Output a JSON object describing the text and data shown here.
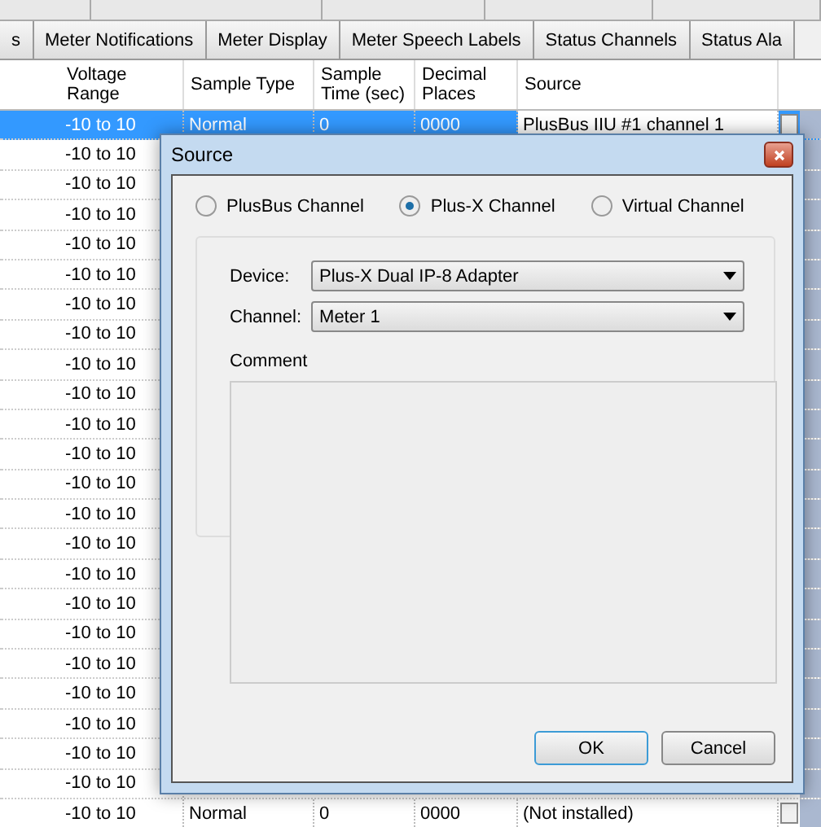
{
  "tabs": [
    {
      "label": "s",
      "selected": false
    },
    {
      "label": "Meter Notifications",
      "selected": false
    },
    {
      "label": "Meter Display",
      "selected": false
    },
    {
      "label": "Meter Speech Labels",
      "selected": false
    },
    {
      "label": "Status Channels",
      "selected": false
    },
    {
      "label": "Status Ala",
      "selected": false
    }
  ],
  "table": {
    "columns": [
      "Voltage Range",
      "Sample Type",
      "Sample Time (sec)",
      "Decimal Places",
      "Source"
    ],
    "rows": [
      {
        "selected": true,
        "cells": [
          "-10 to 10",
          "Normal",
          "0",
          "0000",
          "PlusBus IIU #1 channel 1"
        ]
      },
      {
        "selected": false,
        "cells": [
          "-10 to 10"
        ]
      },
      {
        "selected": false,
        "cells": [
          "-10 to 10"
        ]
      },
      {
        "selected": false,
        "cells": [
          "-10 to 10"
        ]
      },
      {
        "selected": false,
        "cells": [
          "-10 to 10"
        ]
      },
      {
        "selected": false,
        "cells": [
          "-10 to 10"
        ]
      },
      {
        "selected": false,
        "cells": [
          "-10 to 10"
        ]
      },
      {
        "selected": false,
        "cells": [
          "-10 to 10"
        ]
      },
      {
        "selected": false,
        "cells": [
          "-10 to 10"
        ]
      },
      {
        "selected": false,
        "cells": [
          "-10 to 10"
        ]
      },
      {
        "selected": false,
        "cells": [
          "-10 to 10"
        ]
      },
      {
        "selected": false,
        "cells": [
          "-10 to 10"
        ]
      },
      {
        "selected": false,
        "cells": [
          "-10 to 10"
        ]
      },
      {
        "selected": false,
        "cells": [
          "-10 to 10"
        ]
      },
      {
        "selected": false,
        "cells": [
          "-10 to 10"
        ]
      },
      {
        "selected": false,
        "cells": [
          "-10 to 10"
        ]
      },
      {
        "selected": false,
        "cells": [
          "-10 to 10"
        ]
      },
      {
        "selected": false,
        "cells": [
          "-10 to 10"
        ]
      },
      {
        "selected": false,
        "cells": [
          "-10 to 10"
        ]
      },
      {
        "selected": false,
        "cells": [
          "-10 to 10"
        ]
      },
      {
        "selected": false,
        "cells": [
          "-10 to 10"
        ]
      },
      {
        "selected": false,
        "cells": [
          "-10 to 10"
        ]
      },
      {
        "selected": false,
        "cells": [
          "-10 to 10"
        ]
      },
      {
        "selected": false,
        "cells": [
          "-10 to 10",
          "Normal",
          "0",
          "0000",
          "(Not installed)"
        ]
      }
    ]
  },
  "dialog": {
    "title": "Source",
    "options": [
      {
        "label": "PlusBus Channel",
        "selected": false
      },
      {
        "label": "Plus-X Channel",
        "selected": true
      },
      {
        "label": "Virtual Channel",
        "selected": false
      }
    ],
    "device": {
      "label": "Device:",
      "value": "Plus-X Dual IP-8 Adapter"
    },
    "channel": {
      "label": "Channel:",
      "value": "Meter 1"
    },
    "comment": {
      "label": "Comment"
    },
    "buttons": [
      "OK",
      "Cancel"
    ]
  }
}
